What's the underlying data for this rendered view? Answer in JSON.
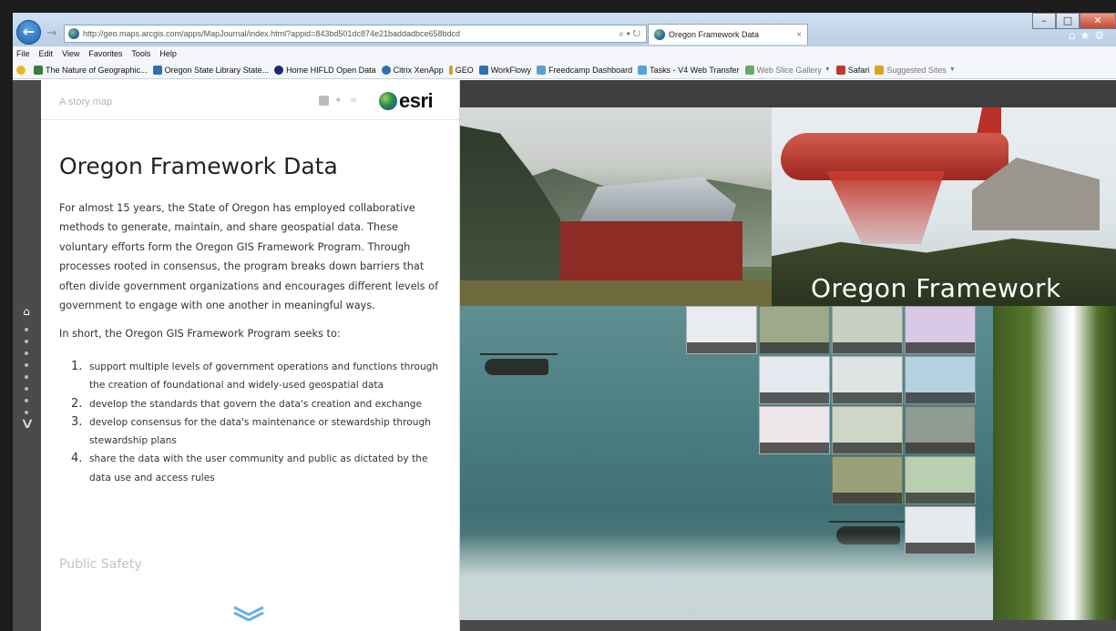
{
  "browser": {
    "url": "http://geo.maps.arcgis.com/apps/MapJournal/index.html?appid=843bd501dc874e21baddadbce658bdcd",
    "address_tools": "⌕ ▾ ↻",
    "tab_title": "Oregon Framework Data",
    "tab_close": "×",
    "window_buttons": [
      "–",
      "□",
      "✕"
    ],
    "right_icons": "⌂★⚙"
  },
  "menu": [
    "File",
    "Edit",
    "View",
    "Favorites",
    "Tools",
    "Help"
  ],
  "favorites": [
    {
      "label": "The Nature of Geographic...",
      "color": "#3a7d3a"
    },
    {
      "label": "Oregon State Library State...",
      "color": "#2e6fb0"
    },
    {
      "label": "Home HIFLD Open Data",
      "color": "#1a2a6b"
    },
    {
      "label": "Citrix XenApp",
      "color": "#2e6fb0"
    },
    {
      "label": "GEO",
      "color": "#c9a227"
    },
    {
      "label": "WorkFlowy",
      "color": "#2e6fb0"
    },
    {
      "label": "Freedcamp Dashboard",
      "color": "#5aa0d8"
    },
    {
      "label": "Tasks - V4 Web Transfer",
      "color": "#5aa0d8"
    },
    {
      "label": "Web Slice Gallery",
      "color": "#6aa86a",
      "dim": true,
      "menu": true
    },
    {
      "label": "Safari",
      "color": "#c0392b",
      "menu": false
    },
    {
      "label": "Suggested Sites",
      "color": "#e0a020",
      "dim": true,
      "menu": true
    }
  ],
  "story": {
    "label": "A story map",
    "brand": "esri",
    "title": "Oregon Framework Data",
    "intro": "For almost 15 years, the State of Oregon has employed collaborative methods to generate, maintain, and share geospatial data. These voluntary efforts form the Oregon GIS Framework Program. Through processes rooted in consensus, the program breaks down barriers that often divide government organizations and encourages different levels of government to engage with one another in meaningful ways.",
    "short": "In short, the Oregon GIS Framework Program seeks to:",
    "goals": [
      {
        "num": "1.",
        "text": "support multiple levels of government operations and functions through the creation of foundational and widely-used geospatial data"
      },
      {
        "num": "2.",
        "text": "develop the standards that govern the data's creation and exchange"
      },
      {
        "num": "3.",
        "text": "develop consensus for the data's maintenance or stewardship through stewardship plans"
      },
      {
        "num": "4.",
        "text": "share the data with the user community and public as dictated by the data use and access rules"
      }
    ],
    "next_section": "Public Safety"
  },
  "stage": {
    "banner_title": "Oregon Framework"
  },
  "nav": {
    "home_icon": "⌂",
    "down_icon": "∨"
  },
  "colors": {
    "accent": "#4a4a4a",
    "scroll_chevron": "#6ab0e8"
  }
}
